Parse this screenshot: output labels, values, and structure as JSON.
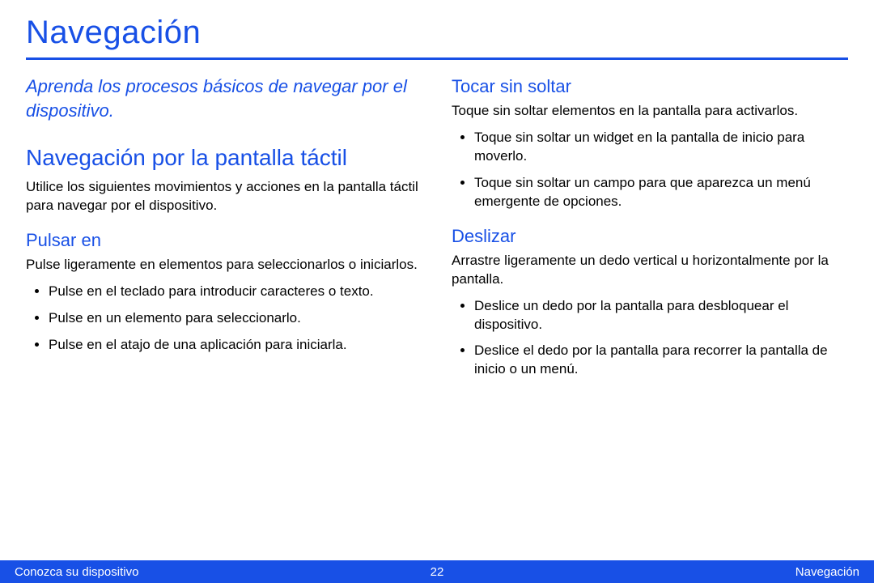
{
  "title": "Navegación",
  "intro": "Aprenda los procesos básicos de navegar por el dispositivo.",
  "section_touch": {
    "heading": "Navegación por la pantalla táctil",
    "desc": "Utilice los siguientes movimientos y acciones en la pantalla táctil para navegar por el dispositivo."
  },
  "pulsar": {
    "heading": "Pulsar en",
    "desc": "Pulse ligeramente en elementos para seleccionarlos o iniciarlos.",
    "items": [
      "Pulse en el teclado para introducir caracteres o texto.",
      "Pulse en un elemento para seleccionarlo.",
      "Pulse en el atajo de una aplicación para iniciarla."
    ]
  },
  "tocar": {
    "heading": "Tocar sin soltar",
    "desc": "Toque sin soltar elementos en la pantalla para activarlos.",
    "items": [
      "Toque sin soltar un widget en la pantalla de inicio para moverlo.",
      "Toque sin soltar un campo para que aparezca un menú emergente de opciones."
    ]
  },
  "deslizar": {
    "heading": "Deslizar",
    "desc": "Arrastre ligeramente un dedo vertical u horizontalmente por la pantalla.",
    "items": [
      "Deslice un dedo por la pantalla para desbloquear el dispositivo.",
      "Deslice el dedo por la pantalla para recorrer la pantalla de inicio o un menú."
    ]
  },
  "footer": {
    "left": "Conozca su dispositivo",
    "page": "22",
    "right": "Navegación"
  }
}
